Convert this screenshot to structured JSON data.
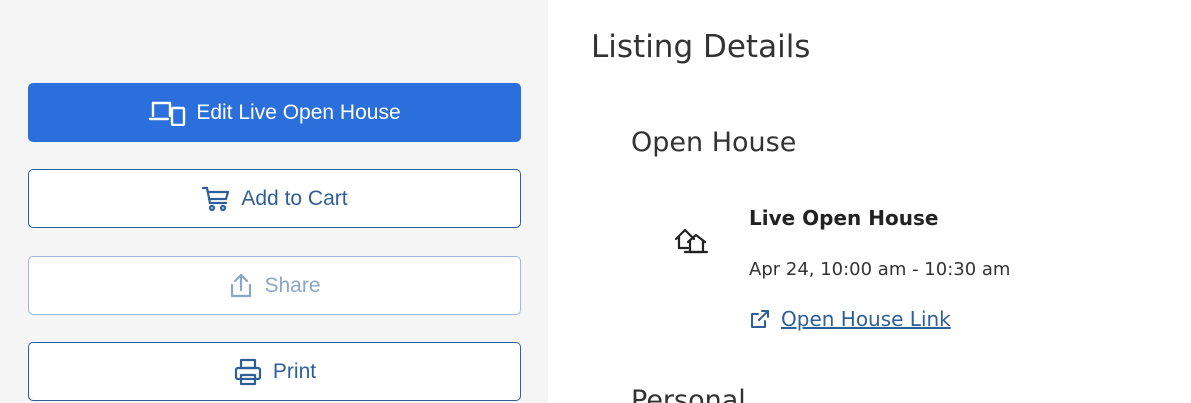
{
  "sidebar": {
    "buttons": {
      "edit_live_open_house": {
        "label": "Edit Live Open House",
        "icon": "devices-icon"
      },
      "add_to_cart": {
        "label": "Add to Cart",
        "icon": "cart-icon"
      },
      "share": {
        "label": "Share",
        "icon": "share-icon"
      },
      "print": {
        "label": "Print",
        "icon": "printer-icon"
      }
    }
  },
  "listing_details": {
    "title": "Listing Details",
    "open_house": {
      "title": "Open House",
      "event": {
        "icon": "house-icon",
        "title": "Live Open House",
        "time": "Apr 24, 10:00 am - 10:30 am",
        "link_label": "Open House Link",
        "link_icon": "external-link-icon"
      }
    },
    "next_section_peek": "Personal"
  },
  "colors": {
    "primary": "#2a6fdb",
    "outline": "#2f5f98",
    "disabled_outline": "#9fb9d9",
    "text": "#333333",
    "sidebar_background": "#f5f5f5"
  }
}
